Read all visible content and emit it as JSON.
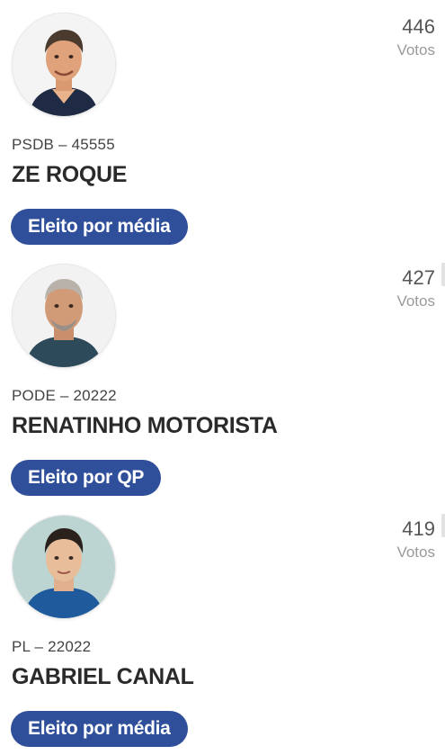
{
  "candidates": [
    {
      "party": "PSDB – 45555",
      "name": "ZE ROQUE",
      "votes": "446",
      "votes_label": "Votos",
      "status": "Eleito por média",
      "status_color": "#2f4f9a"
    },
    {
      "party": "PODE – 20222",
      "name": "RENATINHO MOTORISTA",
      "votes": "427",
      "votes_label": "Votos",
      "status": "Eleito por QP",
      "status_color": "#2f4f9a"
    },
    {
      "party": "PL – 22022",
      "name": "GABRIEL CANAL",
      "votes": "419",
      "votes_label": "Votos",
      "status": "Eleito por média",
      "status_color": "#2f4f9a"
    }
  ]
}
